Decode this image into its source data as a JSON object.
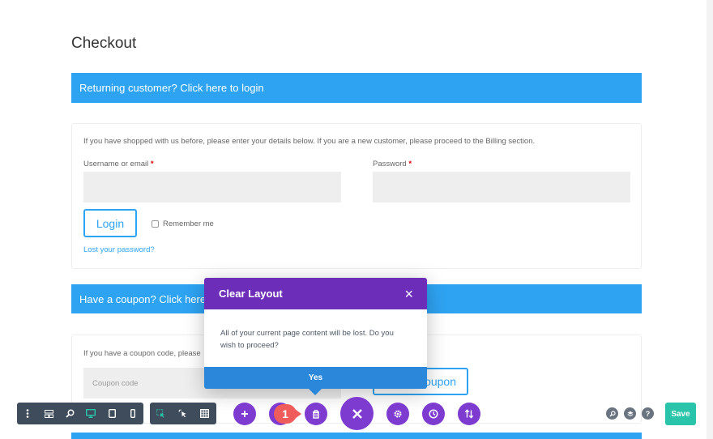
{
  "page": {
    "title": "Checkout"
  },
  "login_notice": {
    "text": "Returning customer? Click here to login"
  },
  "login_form": {
    "intro": "If you have shopped with us before, please enter your details below. If you are a new customer, please proceed to the Billing section.",
    "username_label": "Username or email",
    "password_label": "Password",
    "required_mark": "*",
    "login_button": "Login",
    "remember_label": "Remember me",
    "lost_password": "Lost your password?"
  },
  "coupon_notice": {
    "text": "Have a coupon? Click here"
  },
  "coupon_form": {
    "intro": "If you have a coupon code, please",
    "placeholder": "Coupon code",
    "apply_button_partial": "oupon"
  },
  "modal": {
    "title": "Clear Layout",
    "close_glyph": "×",
    "message": "All of your current page content will be lost. Do you wish to proceed?",
    "confirm_label": "Yes"
  },
  "builder_toolbar": {
    "badge_number": "1",
    "save_label": "Save",
    "help_glyph": "?",
    "accent_color": "#29c4a9",
    "primary_color": "#7e3bd0",
    "modal_header_color": "#6c2eb9",
    "notice_color": "#2ea3f2"
  }
}
